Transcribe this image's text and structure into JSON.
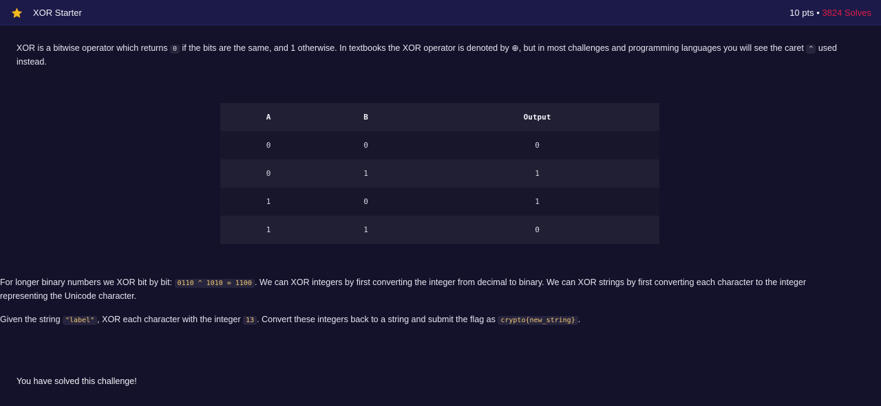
{
  "header": {
    "title": "XOR Starter",
    "points": "10 pts",
    "separator": "•",
    "solves": "3824 Solves",
    "accent_color": "#e11d48",
    "star_color": "#f5b81c",
    "icon": "star-icon"
  },
  "intro": {
    "part1": "XOR is a bitwise operator which returns ",
    "code_zero": "0",
    "part2": " if the bits are the same, and 1 otherwise. In textbooks the XOR operator is denoted by ⊕, but in most challenges and programming languages you will see the caret ",
    "code_caret": "^",
    "part3": " used instead."
  },
  "table": {
    "headers": [
      "A",
      "B",
      "Output"
    ],
    "rows": [
      [
        "0",
        "0",
        "0"
      ],
      [
        "0",
        "1",
        "1"
      ],
      [
        "1",
        "0",
        "1"
      ],
      [
        "1",
        "1",
        "0"
      ]
    ]
  },
  "paragraph2": {
    "part1": "For longer binary numbers we XOR bit by bit: ",
    "code_example": "0110 ^ 1010 = 1100",
    "part2": ". We can XOR integers by first converting the integer from decimal to binary. We can XOR strings by first converting each character to the integer representing the Unicode character."
  },
  "paragraph3": {
    "part1": "Given the string ",
    "code_label": "\"label\"",
    "part2": ", XOR each character with the integer ",
    "code_13": "13",
    "part3": ". Convert these integers back to a string and submit the flag as ",
    "code_flag": "crypto{new_string}",
    "part4": "."
  },
  "status": {
    "solved_text": "You have solved this challenge!"
  }
}
